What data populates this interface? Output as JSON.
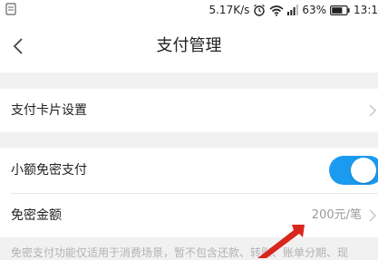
{
  "status_bar": {
    "speed": "5.17K/s",
    "battery": "63%",
    "time": "13:1"
  },
  "header": {
    "title": "支付管理"
  },
  "sections": {
    "card_settings": {
      "label": "支付卡片设置"
    },
    "small_pay": {
      "label": "小额免密支付",
      "enabled": true
    },
    "amount": {
      "label": "免密金额",
      "value": "200元/笔"
    }
  },
  "footnote": "免密支付功能仅适用于消费场景，暂不包含还款、转账、账单分期、现",
  "colors": {
    "accent": "#1a9bf0",
    "annotation_arrow": "#d9261c",
    "background": "#f1f1f1"
  },
  "icons": [
    "back-chevron-icon",
    "chevron-right-icon",
    "alarm-icon",
    "wifi-icon",
    "signal-icon",
    "battery-icon"
  ]
}
